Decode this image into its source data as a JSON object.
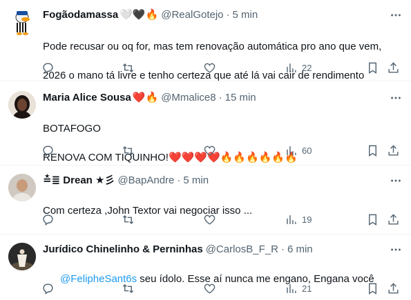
{
  "tweets": [
    {
      "name": "Fogãodamassa",
      "name_emoji": "🤍🖤🔥",
      "handle": "@RealGotejo",
      "time": "5 min",
      "lines": [
        "Pode recusar ou oq for, mas tem renovação automática pro ano que vem,",
        "2026 o mano tá livre e tenho certeza que até lá vai cair de rendimento"
      ],
      "views": "22"
    },
    {
      "name": "Maria Alice Sousa",
      "name_emoji": "❤️🔥",
      "handle": "@Mmalice8",
      "time": "15 min",
      "lines": [
        "BOTAFOGO",
        "RENOVA COM TIQUINHO!❤️❤️❤️❤️🔥🔥🔥🔥🔥🔥"
      ],
      "views": "60"
    },
    {
      "name": "≛≣ Drean ★彡",
      "name_emoji": "",
      "handle": "@BapAndre",
      "time": "5 min",
      "lines": [
        "Com certeza  ,John Textor vai negociar isso ..."
      ],
      "views": "19"
    },
    {
      "name": "Jurídico Chinelinho & Perninhas",
      "name_emoji": "",
      "handle": "@CarlosB_F_R",
      "time": "6 min",
      "mention": "@FelipheSant6s",
      "lines": [
        " seu ídolo. Esse aí nunca me engano, Engana você"
      ],
      "views": "21"
    }
  ],
  "separator": "·",
  "icons": {
    "reply": "reply-icon",
    "retweet": "retweet-icon",
    "like": "like-icon",
    "views": "views-icon",
    "bookmark": "bookmark-icon",
    "share": "share-icon",
    "more": "more-icon"
  },
  "colors": {
    "text": "#0f1419",
    "secondary": "#536471",
    "link": "#1d9bf0",
    "border": "#eff3f4"
  }
}
